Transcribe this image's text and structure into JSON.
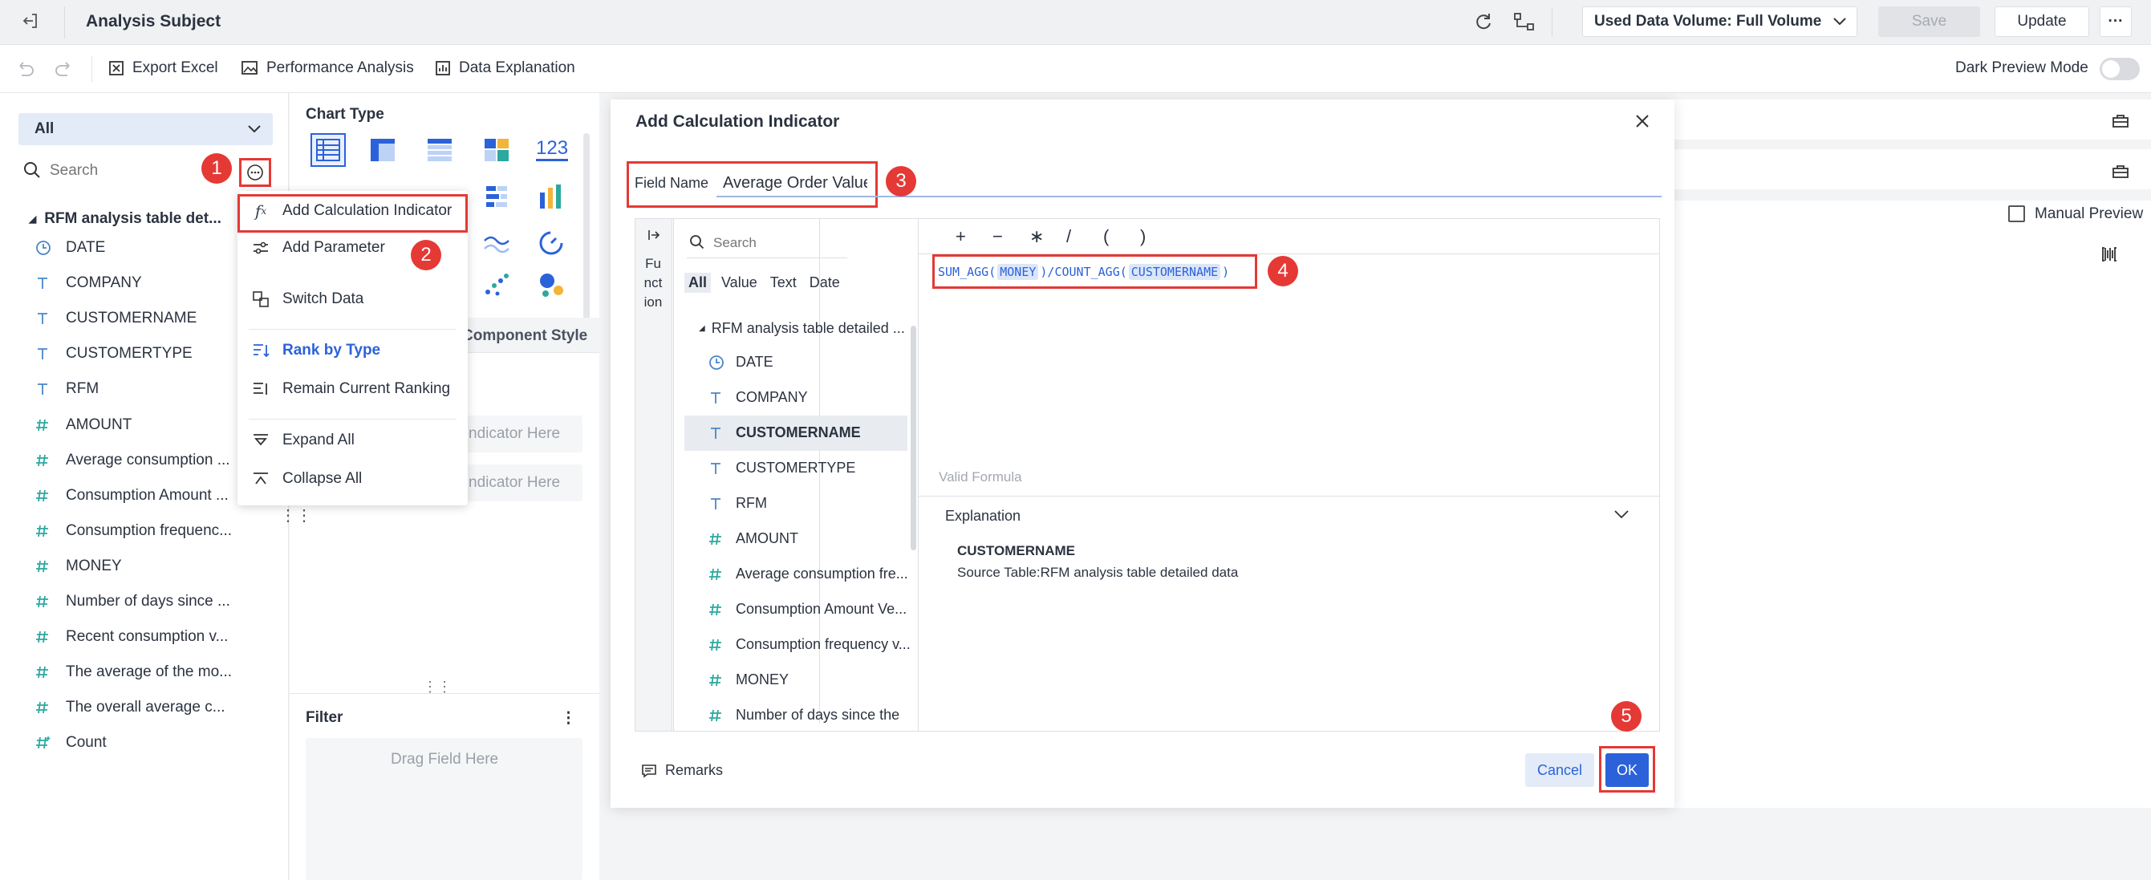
{
  "header": {
    "title": "Analysis Subject",
    "data_volume": "Used Data Volume: Full Volume",
    "save_label": "Save",
    "update_label": "Update"
  },
  "toolbar": {
    "export_excel": "Export Excel",
    "performance_analysis": "Performance Analysis",
    "data_explanation": "Data Explanation",
    "dark_preview": "Dark Preview Mode"
  },
  "left": {
    "filter_value": "All",
    "search_placeholder": "Search",
    "table_name": "RFM analysis table det...",
    "fields": [
      {
        "label": "DATE",
        "icon": "clock-icon"
      },
      {
        "label": "COMPANY",
        "icon": "text-icon"
      },
      {
        "label": "CUSTOMERNAME",
        "icon": "text-icon"
      },
      {
        "label": "CUSTOMERTYPE",
        "icon": "text-icon"
      },
      {
        "label": "RFM",
        "icon": "text-icon"
      },
      {
        "label": "AMOUNT",
        "icon": "number-icon"
      },
      {
        "label": "Average consumption ...",
        "icon": "number-icon"
      },
      {
        "label": "Consumption Amount ...",
        "icon": "number-icon"
      },
      {
        "label": "Consumption frequenc...",
        "icon": "number-icon"
      },
      {
        "label": "MONEY",
        "icon": "number-icon"
      },
      {
        "label": "Number of days since ...",
        "icon": "number-icon"
      },
      {
        "label": "Recent consumption v...",
        "icon": "number-icon"
      },
      {
        "label": "The average of the mo...",
        "icon": "number-icon"
      },
      {
        "label": "The overall average c...",
        "icon": "number-icon"
      },
      {
        "label": "Count",
        "icon": "count-icon"
      }
    ]
  },
  "menu": {
    "items": [
      "Add Calculation Indicator",
      "Add Parameter",
      "Switch Data",
      "Rank by Type",
      "Remain Current Ranking",
      "Expand All",
      "Collapse All"
    ]
  },
  "middle": {
    "chart_type": "Chart Type",
    "component_style": "Component Style",
    "drag_indicator_1": "ndicator Here",
    "drag_indicator_2": "ndicator Here",
    "filter": "Filter",
    "drag_field": "Drag Field Here",
    "chart_number": "123"
  },
  "right": {
    "manual_preview": "Manual Preview"
  },
  "dialog": {
    "title": "Add Calculation Indicator",
    "field_name_label": "Field Name",
    "field_name_value": "Average Order Value",
    "function_label": "Function",
    "search_placeholder": "Search",
    "filter_tabs": [
      "All",
      "Value",
      "Text",
      "Date"
    ],
    "tree_root": "RFM analysis table detailed ...",
    "fields": [
      {
        "label": "DATE",
        "icon": "clock-icon"
      },
      {
        "label": "COMPANY",
        "icon": "text-icon"
      },
      {
        "label": "CUSTOMERNAME",
        "icon": "text-icon"
      },
      {
        "label": "CUSTOMERTYPE",
        "icon": "text-icon"
      },
      {
        "label": "RFM",
        "icon": "text-icon"
      },
      {
        "label": "AMOUNT",
        "icon": "number-icon"
      },
      {
        "label": "Average consumption fre...",
        "icon": "number-icon"
      },
      {
        "label": "Consumption Amount Ve...",
        "icon": "number-icon"
      },
      {
        "label": "Consumption frequency v...",
        "icon": "number-icon"
      },
      {
        "label": "MONEY",
        "icon": "number-icon"
      },
      {
        "label": "Number of days since the",
        "icon": "number-icon"
      }
    ],
    "operators": [
      "+",
      "−",
      "∗",
      "/",
      "(",
      ")"
    ],
    "formula": {
      "fn1": "SUM_AGG(",
      "arg1": "MONEY",
      "mid": ")/COUNT_AGG(",
      "arg2": "CUSTOMERNAME",
      "end": ")"
    },
    "valid_formula": "Valid Formula",
    "explanation": "Explanation",
    "explanation_field": "CUSTOMERNAME",
    "explanation_source": "Source Table:RFM analysis table detailed data",
    "remarks": "Remarks",
    "cancel": "Cancel",
    "ok": "OK"
  },
  "badges": [
    "1",
    "2",
    "3",
    "4",
    "5"
  ],
  "colors": {
    "accent": "#2b62d9",
    "highlight": "#e53935",
    "teal": "#2ba8a0"
  }
}
